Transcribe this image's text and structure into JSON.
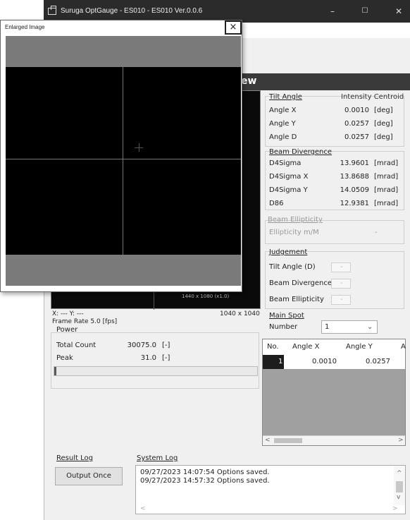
{
  "titlebar": {
    "title": "Suruga OptGauge - ES010 - ES010 Ver.0.0.6",
    "minimize": "–",
    "maximize": "☐",
    "close": "✕"
  },
  "view_header": "ew",
  "under_image": {
    "resolution": "1440 x 1080 (x1.0)",
    "size": "1040 x 1040",
    "coords": "X: --- Y: ---",
    "frame_rate": "Frame Rate  5.0  [fps]"
  },
  "tilt": {
    "title": "Tilt Angle",
    "mode": "Intensity Centroid",
    "rows": [
      {
        "label": "Angle X",
        "value": "0.0010",
        "unit": "[deg]"
      },
      {
        "label": "Angle Y",
        "value": "0.0257",
        "unit": "[deg]"
      },
      {
        "label": "Angle D",
        "value": "0.0257",
        "unit": "[deg]"
      }
    ]
  },
  "divergence": {
    "title": "Beam Divergence",
    "rows": [
      {
        "label": "D4Sigma",
        "value": "13.9601",
        "unit": "[mrad]"
      },
      {
        "label": "D4Sigma X",
        "value": "13.8688",
        "unit": "[mrad]"
      },
      {
        "label": "D4Sigma Y",
        "value": "14.0509",
        "unit": "[mrad]"
      },
      {
        "label": "D86",
        "value": "12.9381",
        "unit": "[mrad]"
      }
    ]
  },
  "ellipticity": {
    "title": "Beam Ellipticity",
    "label": "Ellipticity m/M",
    "value": "-"
  },
  "judgement": {
    "title": "Judgement",
    "rows": [
      {
        "label": "Tilt Angle (D)",
        "value": "-"
      },
      {
        "label": "Beam Divergence",
        "value": "-"
      },
      {
        "label": "Beam Ellipticity",
        "value": "-"
      }
    ]
  },
  "main_spot": {
    "title": "Main Spot",
    "number_label": "Number",
    "number_value": "1"
  },
  "spot_table": {
    "headers": [
      "No.",
      "Angle X",
      "Angle Y",
      "A"
    ],
    "rows": [
      {
        "no": "1",
        "angle_x": "0.0010",
        "angle_y": "0.0257"
      }
    ]
  },
  "power": {
    "title": "Power",
    "rows": [
      {
        "label": "Total Count",
        "value": "30075.0",
        "unit": "[-]"
      },
      {
        "label": "Peak",
        "value": "31.0",
        "unit": "[-]"
      }
    ],
    "progress": 0.01
  },
  "result_log": {
    "title": "Result Log",
    "button": "Output Once"
  },
  "system_log": {
    "title": "System Log",
    "lines": [
      "09/27/2023 14:07:54 Options saved.",
      "09/27/2023 14:57:32 Options saved."
    ]
  },
  "enlarged": {
    "title": "Enlarged Image",
    "close": "×"
  }
}
